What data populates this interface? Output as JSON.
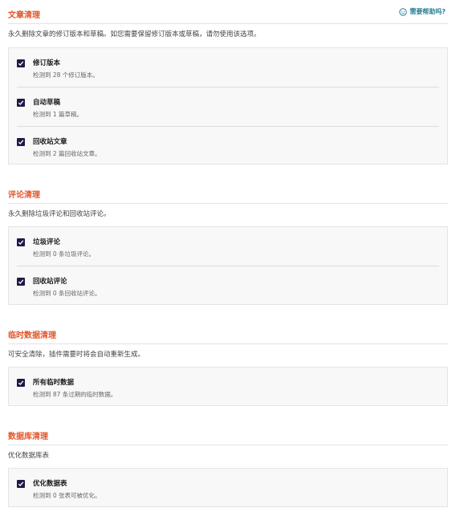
{
  "help_label": "需要帮助吗?",
  "sections": [
    {
      "title": "文章清理",
      "description": "永久删除文章的修订版本和草稿。如您需要保留修订版本或草稿，请勿使用该选项。",
      "items": [
        {
          "label": "修订版本",
          "sub": "检测到 28 个修订版本。",
          "checked": true
        },
        {
          "label": "自动草稿",
          "sub": "检测到 1 篇草稿。",
          "checked": true
        },
        {
          "label": "回收站文章",
          "sub": "检测到 2 篇回收站文章。",
          "checked": true
        }
      ]
    },
    {
      "title": "评论清理",
      "description": "永久删除垃圾评论和回收站评论。",
      "items": [
        {
          "label": "垃圾评论",
          "sub": "检测到 0 条垃圾评论。",
          "checked": true
        },
        {
          "label": "回收站评论",
          "sub": "检测到 0 条回收站评论。",
          "checked": true
        }
      ]
    },
    {
      "title": "临时数据清理",
      "description": "可安全清除，插件需要时将会自动重新生成。",
      "items": [
        {
          "label": "所有临时数据",
          "sub": "检测到 87 条过期的临时数据。",
          "checked": true
        }
      ]
    },
    {
      "title": "数据库清理",
      "description": "优化数据库表",
      "items": [
        {
          "label": "优化数据表",
          "sub": "检测到 0 张表可被优化。",
          "checked": true
        }
      ]
    }
  ]
}
